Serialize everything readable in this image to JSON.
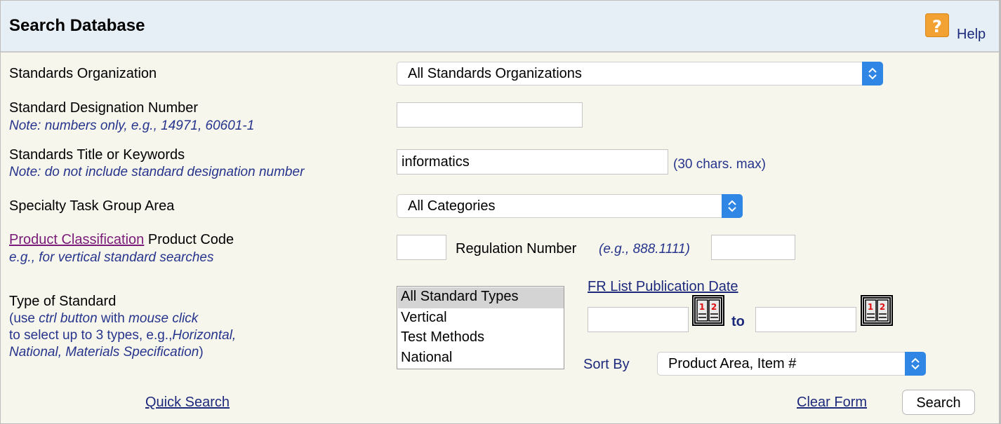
{
  "header": {
    "title": "Search Database",
    "help_label": "Help"
  },
  "form": {
    "standards_org": {
      "label": "Standards Organization",
      "selected": "All Standards Organizations"
    },
    "designation": {
      "label": "Standard Designation Number",
      "note": "Note: numbers only, e.g., 14971, 60601-1",
      "value": ""
    },
    "title_keywords": {
      "label": "Standards Title or Keywords",
      "note": "Note: do not include standard designation number",
      "value": "informatics",
      "hint": "(30 chars. max)"
    },
    "task_group": {
      "label": "Specialty Task Group Area",
      "selected": "All Categories"
    },
    "product": {
      "link": "Product Classification",
      "label": " Product Code",
      "note": "e.g., for vertical standard searches",
      "code_value": "",
      "reg_label": "Regulation Number",
      "reg_hint": "(e.g., 888.1111)",
      "reg_value": ""
    },
    "type": {
      "label": "Type of Standard",
      "note_l1_a": "(use ",
      "note_l1_b": "ctrl button",
      "note_l1_c": " with ",
      "note_l1_d": "mouse click",
      "note_l2_a": "to select up to 3 types, e.g.,",
      "note_l2_b": "Horizontal,",
      "note_l3_a": "National, Materials Specification",
      "note_l3_b": ")",
      "options": [
        "All Standard Types",
        "Vertical",
        "Test Methods",
        "National"
      ],
      "selected_index": 0
    },
    "fr_date": {
      "label": "FR List Publication Date",
      "from_value": "",
      "to_label": "to",
      "to_value": ""
    },
    "sort": {
      "label": "Sort By",
      "selected": "Product Area, Item #"
    }
  },
  "footer": {
    "quick_search": "Quick Search",
    "clear_form": "Clear Form",
    "search": "Search"
  },
  "colors": {
    "header_bg": "#e6eef6",
    "body_bg": "#f6f6ed",
    "link": "#1d2a7c",
    "visited_link": "#7a1a78",
    "note": "#26348c",
    "select_arrow": "#2f86e5",
    "help_icon": "#f2a233"
  }
}
